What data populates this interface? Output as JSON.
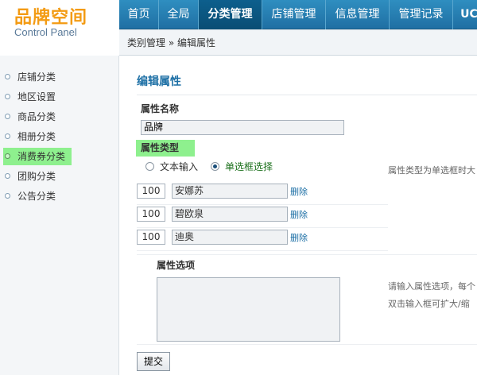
{
  "logo": {
    "title": "品牌空间",
    "subtitle": "Control Panel"
  },
  "topnav": {
    "tabs": [
      {
        "label": "首页"
      },
      {
        "label": "全局"
      },
      {
        "label": "分类管理"
      },
      {
        "label": "店铺管理"
      },
      {
        "label": "信息管理"
      },
      {
        "label": "管理记录"
      },
      {
        "label": "UC"
      }
    ]
  },
  "breadcrumb": "类别管理 » 编辑属性",
  "sidebar": {
    "items": [
      {
        "label": "店铺分类"
      },
      {
        "label": "地区设置"
      },
      {
        "label": "商品分类"
      },
      {
        "label": "相册分类"
      },
      {
        "label": "消费券分类"
      },
      {
        "label": "团购分类"
      },
      {
        "label": "公告分类"
      }
    ]
  },
  "main": {
    "title": "编辑属性",
    "name_label": "属性名称",
    "name_value": "品牌",
    "type_label": "属性类型",
    "type_options": [
      {
        "label": "文本输入",
        "checked": false
      },
      {
        "label": "单选框选择",
        "checked": true
      }
    ],
    "type_hint": "属性类型为单选框时大",
    "options": [
      {
        "sort": "100",
        "name": "安娜苏",
        "delete": "删除"
      },
      {
        "sort": "100",
        "name": "碧欧泉",
        "delete": "删除"
      },
      {
        "sort": "100",
        "name": "迪奥",
        "delete": "删除"
      }
    ],
    "options_label": "属性选项",
    "options_hint_line1": "请输入属性选项，每个",
    "options_hint_line2": "双击输入框可扩大/缩",
    "submit_label": "提交"
  },
  "colors": {
    "nav_blue": "#1f6fa3",
    "logo_orange": "#f39b13",
    "highlight_green": "#8ef08e",
    "link_blue": "#1c6fa5"
  }
}
